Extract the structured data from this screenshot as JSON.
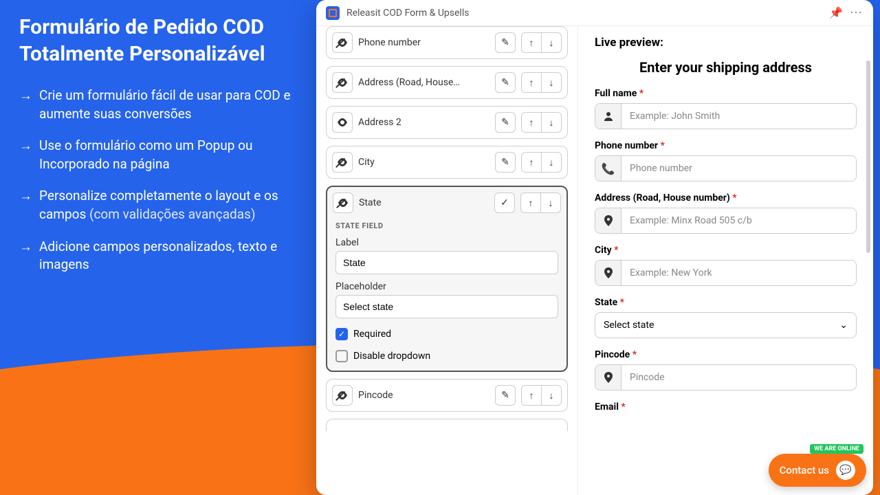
{
  "sidebar": {
    "title_line1": "Formulário de Pedido COD",
    "title_line2": "Totalmente Personalizável",
    "features": [
      {
        "text": "Crie um formulário fácil de usar para COD e aumente suas conversões"
      },
      {
        "text": "Use o formulário como um Popup ou Incorporado na página"
      },
      {
        "text_main": "Personalize completamente o layout e os campos ",
        "text_dim": "(com validações avançadas)"
      },
      {
        "text": "Adicione campos personalizados, texto e imagens"
      }
    ]
  },
  "titlebar": {
    "app_name": "Releasit COD Form & Upsells"
  },
  "editor": {
    "fields": [
      {
        "label": "Phone number",
        "visible": false
      },
      {
        "label": "Address (Road, House…",
        "visible": false
      },
      {
        "label": "Address 2",
        "visible": true
      },
      {
        "label": "City",
        "visible": false
      },
      {
        "label": "State",
        "visible": false,
        "active": true
      },
      {
        "label": "Pincode",
        "visible": false
      }
    ],
    "detail": {
      "section_title": "STATE FIELD",
      "label_caption": "Label",
      "label_value": "State",
      "placeholder_caption": "Placeholder",
      "placeholder_value": "Select state",
      "required_label": "Required",
      "required_checked": true,
      "disable_label": "Disable dropdown",
      "disable_checked": false
    }
  },
  "preview": {
    "heading": "Live preview:",
    "form_title": "Enter your shipping address",
    "fields": {
      "fullname": {
        "label": "Full name",
        "placeholder": "Example: John Smith"
      },
      "phone": {
        "label": "Phone number",
        "placeholder": "Phone number"
      },
      "address": {
        "label": "Address (Road, House number)",
        "placeholder": "Example: Minx Road 505 c/b"
      },
      "city": {
        "label": "City",
        "placeholder": "Example: New York"
      },
      "state": {
        "label": "State",
        "placeholder": "Select state"
      },
      "pincode": {
        "label": "Pincode",
        "placeholder": "Pincode"
      },
      "email": {
        "label": "Email"
      }
    }
  },
  "contact": {
    "text": "Contact us",
    "badge": "WE ARE ONLINE"
  }
}
